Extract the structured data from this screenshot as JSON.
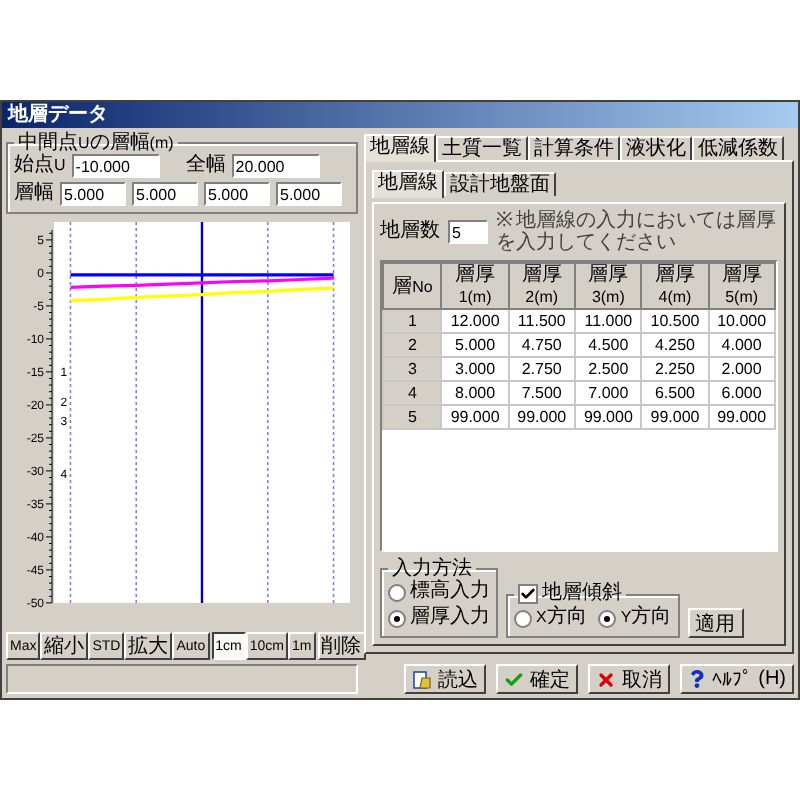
{
  "window": {
    "title": "地層データ"
  },
  "left": {
    "spacing_group": {
      "title": "中間点Uの層幅(m)",
      "start_label": "始点U",
      "start_value": "-10.000",
      "width_label": "全幅",
      "width_value": "20.000",
      "spacing_label": "層幅",
      "spacing_values": [
        "5.000",
        "5.000",
        "5.000",
        "5.000"
      ]
    },
    "chart_data": {
      "type": "line",
      "grid": true,
      "categories": [
        null,
        null,
        null,
        null,
        null,
        null,
        null,
        null,
        null
      ],
      "ylim": [
        -50,
        6.5
      ],
      "yticks": [
        5,
        0,
        -5,
        -10,
        -15,
        -20,
        -25,
        -30,
        -35,
        -40,
        -45,
        -50
      ],
      "series": [
        {
          "color": "#0000ff",
          "values": [
            -0.3,
            -0.3,
            -0.3,
            -0.3,
            -0.3,
            -0.3,
            -0.3,
            -0.3,
            -0.3
          ]
        },
        {
          "color": "#ff00ff",
          "values": [
            -2.2,
            -2.0,
            -1.9,
            -1.7,
            -1.5,
            -1.3,
            -1.2,
            -1.0,
            -0.8
          ]
        },
        {
          "color": "#ffff00",
          "values": [
            -4.2,
            -4.0,
            -3.7,
            -3.5,
            -3.3,
            -3.0,
            -2.8,
            -2.5,
            -2.3
          ]
        }
      ],
      "annotations": [
        "1",
        "2",
        "3",
        "4"
      ]
    },
    "zoom_buttons": [
      "Max",
      "縮小",
      "STD",
      "拡大",
      "Auto"
    ],
    "scale_buttons": [
      {
        "label": "1cm",
        "selected": true
      },
      {
        "label": "10cm",
        "selected": false
      },
      {
        "label": "1m",
        "selected": false
      }
    ],
    "delete_button": "削除"
  },
  "right": {
    "tabs": [
      {
        "label": "地層線",
        "selected": true
      },
      {
        "label": "土質一覧",
        "selected": false
      },
      {
        "label": "計算条件",
        "selected": false
      },
      {
        "label": "液状化",
        "selected": false
      },
      {
        "label": "低減係数",
        "selected": false
      }
    ],
    "subtabs": [
      {
        "label": "地層線",
        "selected": true
      },
      {
        "label": "設計地盤面",
        "selected": false
      }
    ],
    "layer_count": {
      "label": "地層数",
      "value": "5",
      "note": "※ 地層線の入力においては層厚を入力してください"
    },
    "table": {
      "columns": [
        "層No",
        "層厚1(m)",
        "層厚2(m)",
        "層厚3(m)",
        "層厚4(m)",
        "層厚5(m)"
      ],
      "rows": [
        [
          "1",
          "12.000",
          "11.500",
          "11.000",
          "10.500",
          "10.000"
        ],
        [
          "2",
          "5.000",
          "4.750",
          "4.500",
          "4.250",
          "4.000"
        ],
        [
          "3",
          "3.000",
          "2.750",
          "2.500",
          "2.250",
          "2.000"
        ],
        [
          "4",
          "8.000",
          "7.500",
          "7.000",
          "6.500",
          "6.000"
        ],
        [
          "5",
          "99.000",
          "99.000",
          "99.000",
          "99.000",
          "99.000"
        ]
      ]
    },
    "input_method": {
      "title": "入力方法",
      "options": [
        {
          "label": "標高入力",
          "selected": false
        },
        {
          "label": "層厚入力",
          "selected": true
        }
      ]
    },
    "slope": {
      "label": "地層傾斜",
      "checked": true,
      "options": [
        {
          "label": "X方向",
          "selected": false
        },
        {
          "label": "Y方向",
          "selected": true
        }
      ]
    },
    "apply_button": "適用"
  },
  "buttons": [
    {
      "kind": "load",
      "label": "読込"
    },
    {
      "kind": "confirm",
      "label": "確定"
    },
    {
      "kind": "cancel",
      "label": "取消"
    },
    {
      "kind": "help",
      "label": "ﾍﾙﾌﾟ (H)"
    }
  ]
}
